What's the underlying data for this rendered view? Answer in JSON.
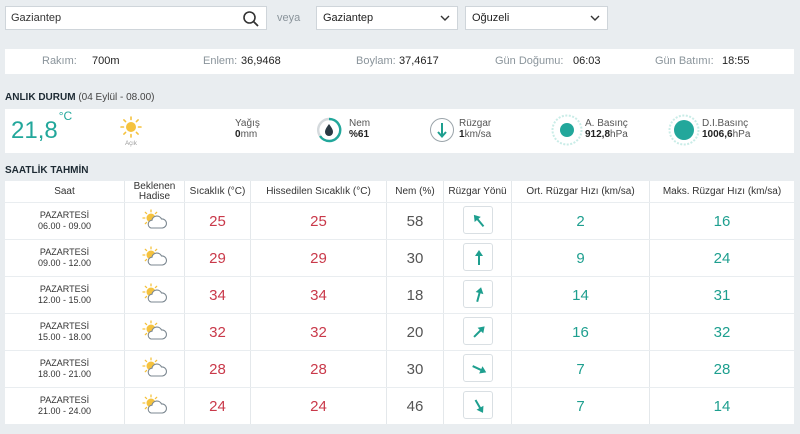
{
  "search": {
    "value": "Gaziantep"
  },
  "veya": "veya",
  "province_select": {
    "value": "Gaziantep"
  },
  "district_select": {
    "value": "Oğuzeli"
  },
  "info": {
    "rakim_label": "Rakım:",
    "rakim_value": "700m",
    "enlem_label": "Enlem:",
    "enlem_value": "36,9468",
    "boylam_label": "Boylam:",
    "boylam_value": "37,4617",
    "dogumu_label": "Gün Doğumu:",
    "dogumu_value": "06:03",
    "batimi_label": "Gün Batımı:",
    "batimi_value": "18:55"
  },
  "current": {
    "title": "ANLIK DURUM",
    "subtitle": "(04 Eylül - 08.00)",
    "temperature": "21,8",
    "unit": "°C",
    "condition": "Açık",
    "yagis_label": "Yağış",
    "yagis_value": "0",
    "yagis_unit": "mm",
    "nem_label": "Nem",
    "nem_value": "%61",
    "ruzgar_label": "Rüzgar",
    "ruzgar_value": "1",
    "ruzgar_unit": "km/sa",
    "abasinc_label": "A. Basınç",
    "abasinc_value": "912,8",
    "abasinc_unit": "hPa",
    "dibasinc_label": "D.I.Basınç",
    "dibasinc_value": "1006,6",
    "dibasinc_unit": "hPa"
  },
  "forecast": {
    "title": "SAATLİK TAHMİN",
    "headers": {
      "saat": "Saat",
      "hadise": "Beklenen Hadise",
      "sicaklik": "Sıcaklık (°C)",
      "hissedilen": "Hissedilen Sıcaklık (°C)",
      "nem": "Nem (%)",
      "yon": "Rüzgar Yönü",
      "ort": "Ort. Rüzgar Hızı (km/sa)",
      "maks": "Maks. Rüzgar Hızı (km/sa)"
    },
    "rows": [
      {
        "day": "PAZARTESİ",
        "time": "06.00 - 09.00",
        "temp": "25",
        "feels": "25",
        "humidity": "58",
        "wind_rotation": -40,
        "avg": "2",
        "max": "16"
      },
      {
        "day": "PAZARTESİ",
        "time": "09.00 - 12.00",
        "temp": "29",
        "feels": "29",
        "humidity": "30",
        "wind_rotation": 0,
        "avg": "9",
        "max": "24"
      },
      {
        "day": "PAZARTESİ",
        "time": "12.00 - 15.00",
        "temp": "34",
        "feels": "34",
        "humidity": "18",
        "wind_rotation": 15,
        "avg": "14",
        "max": "31"
      },
      {
        "day": "PAZARTESİ",
        "time": "15.00 - 18.00",
        "temp": "32",
        "feels": "32",
        "humidity": "20",
        "wind_rotation": 45,
        "avg": "16",
        "max": "32"
      },
      {
        "day": "PAZARTESİ",
        "time": "18.00 - 21.00",
        "temp": "28",
        "feels": "28",
        "humidity": "30",
        "wind_rotation": 115,
        "avg": "7",
        "max": "28"
      },
      {
        "day": "PAZARTESİ",
        "time": "21.00 - 24.00",
        "temp": "24",
        "feels": "24",
        "humidity": "46",
        "wind_rotation": 150,
        "avg": "7",
        "max": "14"
      }
    ]
  },
  "colors": {
    "teal": "#22a79b",
    "red": "#c9394a",
    "background": "#e9edf0"
  },
  "icons": {
    "search": "search-icon",
    "chevron": "chevron-down-icon",
    "sun": "sun-icon",
    "partly_cloudy": "partly-cloudy-icon",
    "humidity": "humidity-drop-icon",
    "wind": "wind-arrow-icon",
    "pressure": "pressure-icon"
  }
}
